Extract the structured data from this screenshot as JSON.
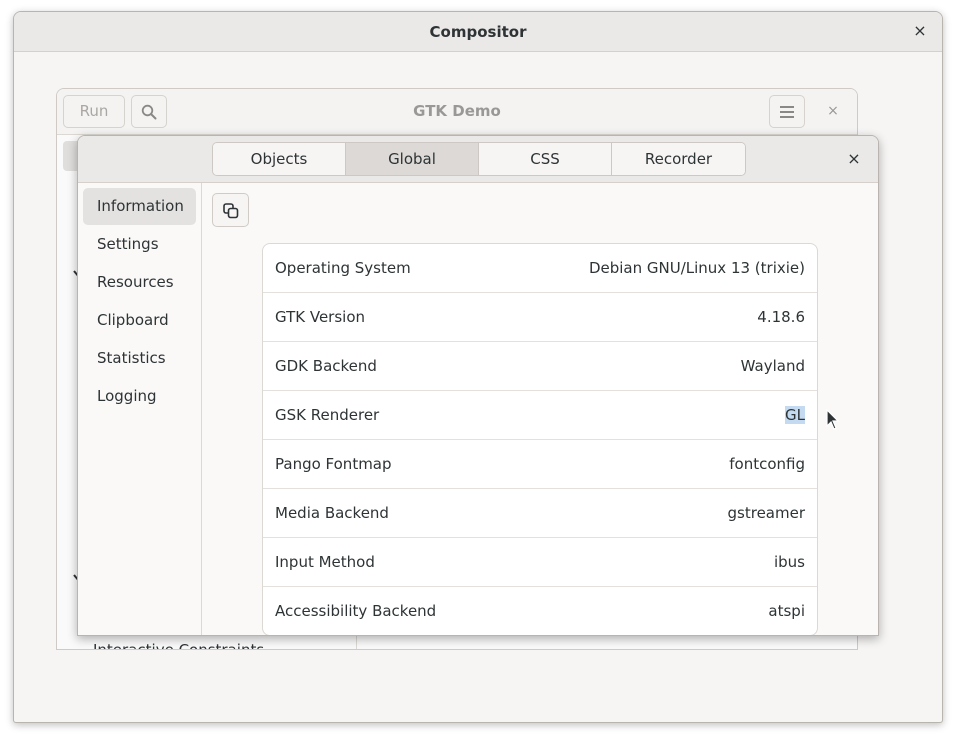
{
  "compositor": {
    "title": "Compositor",
    "close_icon": "×"
  },
  "demo": {
    "title": "GTK Demo",
    "run_label": "Run",
    "close_icon": "×",
    "partial_item": "Interactive Constraints"
  },
  "inspector": {
    "tabs": [
      {
        "label": "Objects"
      },
      {
        "label": "Global"
      },
      {
        "label": "CSS"
      },
      {
        "label": "Recorder"
      }
    ],
    "active_tab": "Global",
    "close_icon": "×",
    "sidebar": [
      {
        "label": "Information"
      },
      {
        "label": "Settings"
      },
      {
        "label": "Resources"
      },
      {
        "label": "Clipboard"
      },
      {
        "label": "Statistics"
      },
      {
        "label": "Logging"
      }
    ],
    "active_sidebar": "Information",
    "info": [
      {
        "label": "Operating System",
        "value": "Debian GNU/Linux 13 (trixie)"
      },
      {
        "label": "GTK Version",
        "value": "4.18.6"
      },
      {
        "label": "GDK Backend",
        "value": "Wayland"
      },
      {
        "label": "GSK Renderer",
        "value": "GL"
      },
      {
        "label": "Pango Fontmap",
        "value": "fontconfig"
      },
      {
        "label": "Media Backend",
        "value": "gstreamer"
      },
      {
        "label": "Input Method",
        "value": "ibus"
      },
      {
        "label": "Accessibility Backend",
        "value": "atspi"
      }
    ]
  },
  "icons": {
    "copy": "copy-icon",
    "search": "search-icon",
    "menu": "hamburger-menu-icon",
    "close": "close-icon",
    "pointer": "mouse-pointer-icon"
  },
  "colors": {
    "selection": "#c4daf1",
    "active_tab": "#dcd9d6",
    "active_sidebar": "#e4e2e0"
  }
}
